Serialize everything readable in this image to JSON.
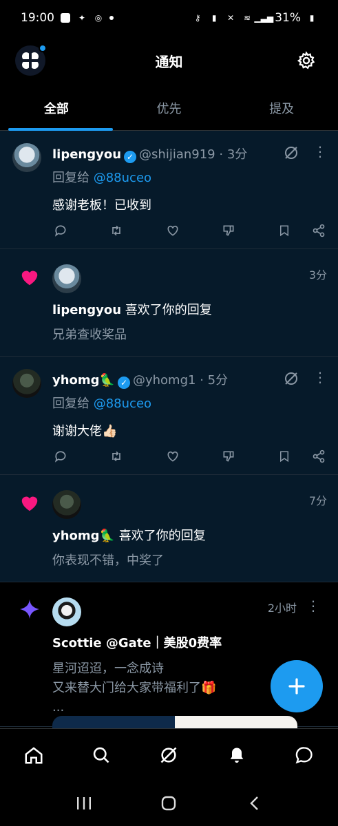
{
  "status_bar": {
    "time": "19:00",
    "battery": "31%"
  },
  "header": {
    "title": "通知"
  },
  "tabs": [
    {
      "label": "全部",
      "active": true
    },
    {
      "label": "优先",
      "active": false
    },
    {
      "label": "提及",
      "active": false
    }
  ],
  "notifications": [
    {
      "type": "reply",
      "name": "lipengyou",
      "handle": "@shijian919",
      "time": "3分",
      "reply_prefix": "回复给",
      "reply_to": "@88uceo",
      "text": "感谢老板！已收到"
    },
    {
      "type": "like",
      "time": "3分",
      "name": "lipengyou",
      "action": "喜欢了你的回复",
      "snippet": "兄弟查收奖品"
    },
    {
      "type": "reply",
      "name": "yhomg🦜",
      "handle": "@yhomg1",
      "time": "5分",
      "reply_prefix": "回复给",
      "reply_to": "@88uceo",
      "text": "谢谢大佬👍🏻"
    },
    {
      "type": "like",
      "time": "7分",
      "name": "yhomg🦜",
      "action": "喜欢了你的回复",
      "snippet": "你表现不错，中奖了"
    },
    {
      "type": "recommendation",
      "time": "2小时",
      "title": "Scottie @Gate｜美股0费率",
      "lines": [
        "星河迢迢，一念成诗",
        "又来替大门给大家带福利了🎁",
        "..."
      ]
    }
  ],
  "icons": {
    "logo": "app-logo-icon",
    "settings": "gear-icon",
    "compose": "plus-icon",
    "nav": [
      "home-icon",
      "search-icon",
      "grok-icon",
      "bell-icon",
      "message-icon"
    ]
  },
  "colors": {
    "accent": "#1d9bf0",
    "like": "#f91880",
    "background": "#000000",
    "unread_bg": "#061a2a"
  }
}
